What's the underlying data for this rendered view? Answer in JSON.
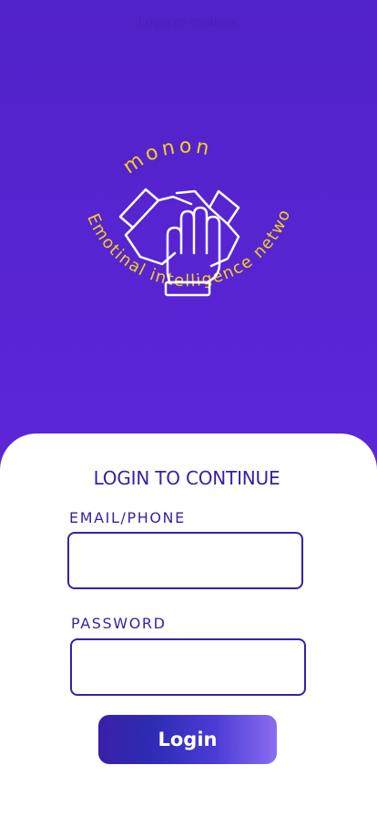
{
  "header": {
    "hint_text": "Login to continue"
  },
  "logo": {
    "brand_text": "monon",
    "tagline": "Emotinal intelligence network",
    "accent_color": "#f0d21e"
  },
  "form": {
    "title": "LOGIN TO CONTINUE",
    "email_label": "EMAIL/PHONE",
    "email_value": "",
    "email_placeholder": "",
    "password_label": "PASSWORD",
    "password_value": "",
    "password_placeholder": "",
    "login_label": "Login"
  },
  "colors": {
    "background": "#5b25d8",
    "card": "#ffffff",
    "primary_text": "#3a1fa0"
  }
}
